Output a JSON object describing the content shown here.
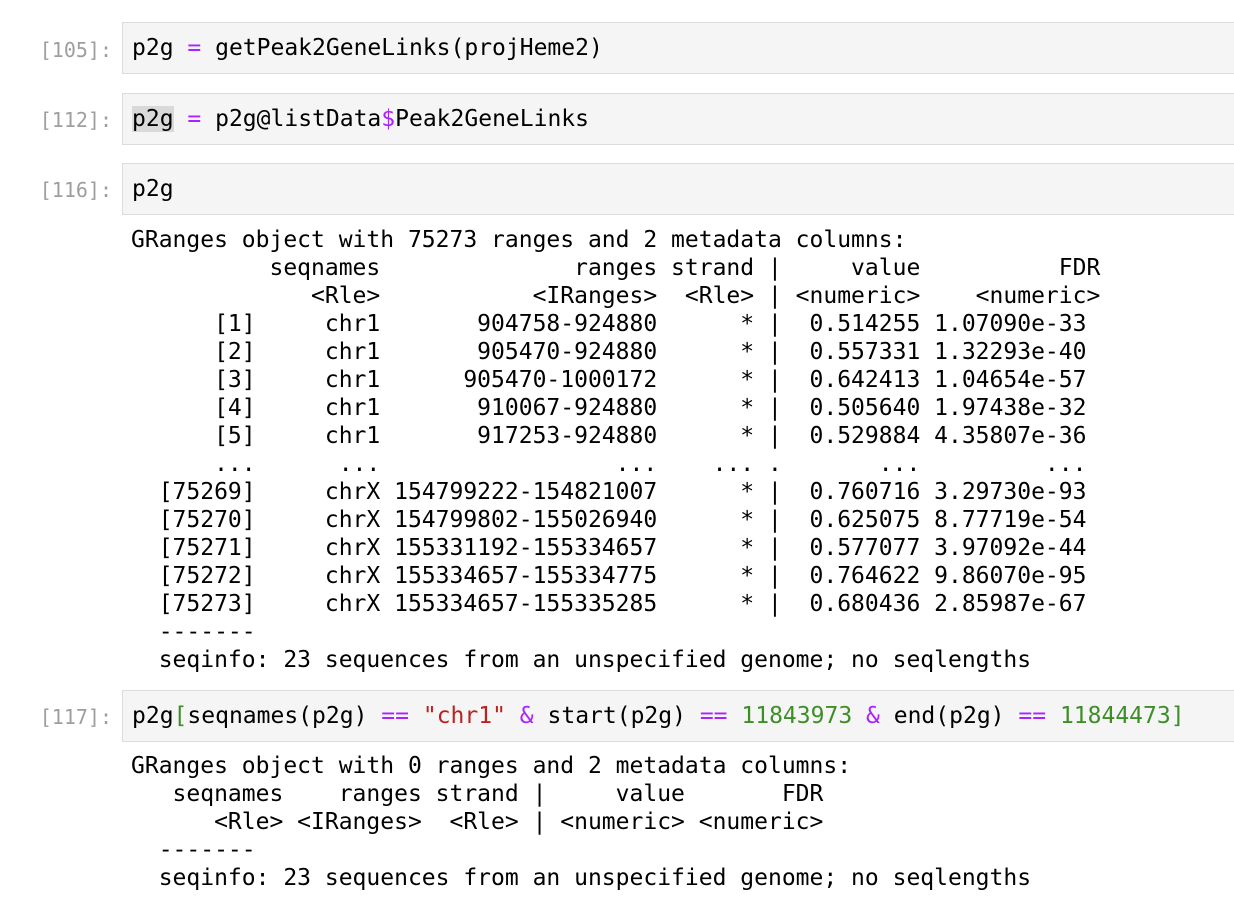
{
  "cells": [
    {
      "prompt": "[105]:",
      "code": [
        {
          "t": "p2g ",
          "c": ""
        },
        {
          "t": "=",
          "c": "op"
        },
        {
          "t": " getPeak2GeneLinks(projHeme2)",
          "c": ""
        }
      ]
    },
    {
      "prompt": "[112]:",
      "code": [
        {
          "t": "p2g",
          "c": "sel"
        },
        {
          "t": " ",
          "c": ""
        },
        {
          "t": "=",
          "c": "op"
        },
        {
          "t": " p2g@listData",
          "c": ""
        },
        {
          "t": "$",
          "c": "op"
        },
        {
          "t": "Peak2GeneLinks",
          "c": ""
        }
      ]
    },
    {
      "prompt": "[116]:",
      "code": [
        {
          "t": "p2g",
          "c": ""
        }
      ],
      "output": [
        "GRanges object with 75273 ranges and 2 metadata columns:",
        "          seqnames              ranges strand |     value          FDR",
        "             <Rle>           <IRanges>  <Rle> | <numeric>    <numeric>",
        "      [1]     chr1       904758-924880      * |  0.514255 1.07090e-33",
        "      [2]     chr1       905470-924880      * |  0.557331 1.32293e-40",
        "      [3]     chr1      905470-1000172      * |  0.642413 1.04654e-57",
        "      [4]     chr1       910067-924880      * |  0.505640 1.97438e-32",
        "      [5]     chr1       917253-924880      * |  0.529884 4.35807e-36",
        "      ...      ...                 ...    ... .       ...         ...",
        "  [75269]     chrX 154799222-154821007      * |  0.760716 3.29730e-93",
        "  [75270]     chrX 154799802-155026940      * |  0.625075 8.77719e-54",
        "  [75271]     chrX 155331192-155334657      * |  0.577077 3.97092e-44",
        "  [75272]     chrX 155334657-155334775      * |  0.764622 9.86070e-95",
        "  [75273]     chrX 155334657-155335285      * |  0.680436 2.85987e-67",
        "  -------",
        "  seqinfo: 23 sequences from an unspecified genome; no seqlengths"
      ]
    },
    {
      "prompt": "[117]:",
      "code": [
        {
          "t": "p2g",
          "c": ""
        },
        {
          "t": "[",
          "c": "num"
        },
        {
          "t": "seqnames(p2g) ",
          "c": ""
        },
        {
          "t": "==",
          "c": "op"
        },
        {
          "t": " ",
          "c": ""
        },
        {
          "t": "\"chr1\"",
          "c": "str"
        },
        {
          "t": " ",
          "c": ""
        },
        {
          "t": "&",
          "c": "op"
        },
        {
          "t": " start(p2g) ",
          "c": ""
        },
        {
          "t": "==",
          "c": "op"
        },
        {
          "t": " ",
          "c": ""
        },
        {
          "t": "11843973",
          "c": "num"
        },
        {
          "t": " ",
          "c": ""
        },
        {
          "t": "&",
          "c": "op"
        },
        {
          "t": " end(p2g) ",
          "c": ""
        },
        {
          "t": "==",
          "c": "op"
        },
        {
          "t": " ",
          "c": ""
        },
        {
          "t": "11844473",
          "c": "num"
        },
        {
          "t": "]",
          "c": "num"
        }
      ],
      "output": [
        "GRanges object with 0 ranges and 2 metadata columns:",
        "   seqnames    ranges strand |     value       FDR",
        "      <Rle> <IRanges>  <Rle> | <numeric> <numeric>",
        "  -------",
        "  seqinfo: 23 sequences from an unspecified genome; no seqlengths"
      ]
    }
  ]
}
